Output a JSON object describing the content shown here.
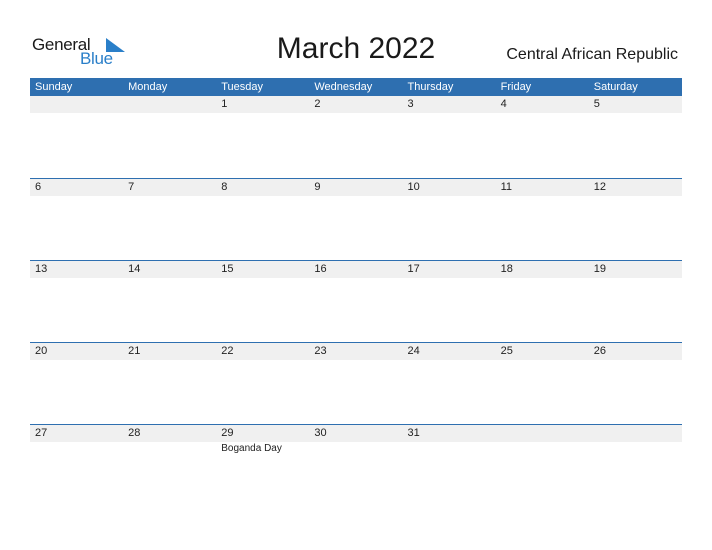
{
  "logo": {
    "line1": "General",
    "line2": "Blue"
  },
  "title": "March 2022",
  "country": "Central African Republic",
  "colors": {
    "header": "#2e6fb0",
    "brand": "#2a7fc9",
    "strip": "#f0f0f0"
  },
  "weekdays": [
    "Sunday",
    "Monday",
    "Tuesday",
    "Wednesday",
    "Thursday",
    "Friday",
    "Saturday"
  ],
  "weeks": [
    {
      "days": [
        "",
        "",
        "1",
        "2",
        "3",
        "4",
        "5"
      ],
      "events": [
        "",
        "",
        "",
        "",
        "",
        "",
        ""
      ]
    },
    {
      "days": [
        "6",
        "7",
        "8",
        "9",
        "10",
        "11",
        "12"
      ],
      "events": [
        "",
        "",
        "",
        "",
        "",
        "",
        ""
      ]
    },
    {
      "days": [
        "13",
        "14",
        "15",
        "16",
        "17",
        "18",
        "19"
      ],
      "events": [
        "",
        "",
        "",
        "",
        "",
        "",
        ""
      ]
    },
    {
      "days": [
        "20",
        "21",
        "22",
        "23",
        "24",
        "25",
        "26"
      ],
      "events": [
        "",
        "",
        "",
        "",
        "",
        "",
        ""
      ]
    },
    {
      "days": [
        "27",
        "28",
        "29",
        "30",
        "31",
        "",
        ""
      ],
      "events": [
        "",
        "",
        "Boganda Day",
        "",
        "",
        "",
        ""
      ]
    }
  ]
}
